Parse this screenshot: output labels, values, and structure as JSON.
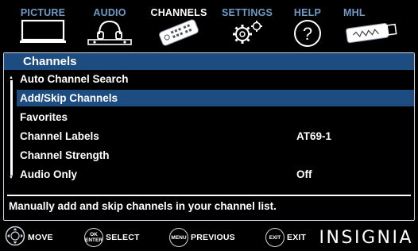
{
  "tabs": [
    {
      "label": "PICTURE",
      "icon": "tv-icon",
      "active": false
    },
    {
      "label": "AUDIO",
      "icon": "headphones-icon",
      "active": false
    },
    {
      "label": "CHANNELS",
      "icon": "remote-icon",
      "active": true
    },
    {
      "label": "SETTINGS",
      "icon": "gears-icon",
      "active": false
    },
    {
      "label": "HELP",
      "icon": "help-icon",
      "active": false
    },
    {
      "label": "MHL",
      "icon": "usb-stick-icon",
      "active": false
    }
  ],
  "panel": {
    "title": "Channels",
    "items": [
      {
        "label": "Auto Channel Search",
        "value": ""
      },
      {
        "label": "Add/Skip Channels",
        "value": "",
        "selected": true
      },
      {
        "label": "Favorites",
        "value": ""
      },
      {
        "label": "Channel Labels",
        "value": "AT69-1"
      },
      {
        "label": "Channel Strength",
        "value": ""
      },
      {
        "label": "Audio Only",
        "value": "Off"
      }
    ],
    "description": "Manually add and skip channels in your channel list."
  },
  "bottom": {
    "move": "MOVE",
    "select": "SELECT",
    "ok_top": "OK",
    "ok_bottom": "ENTER",
    "menu_key": "MENU",
    "previous": "PREVIOUS",
    "exit_key": "EXIT",
    "exit": "EXIT",
    "brand": "INSIGNIA"
  },
  "colors": {
    "accent": "#1d4d80",
    "tab_inactive": "#6f9bc6",
    "text": "#ffffff"
  }
}
